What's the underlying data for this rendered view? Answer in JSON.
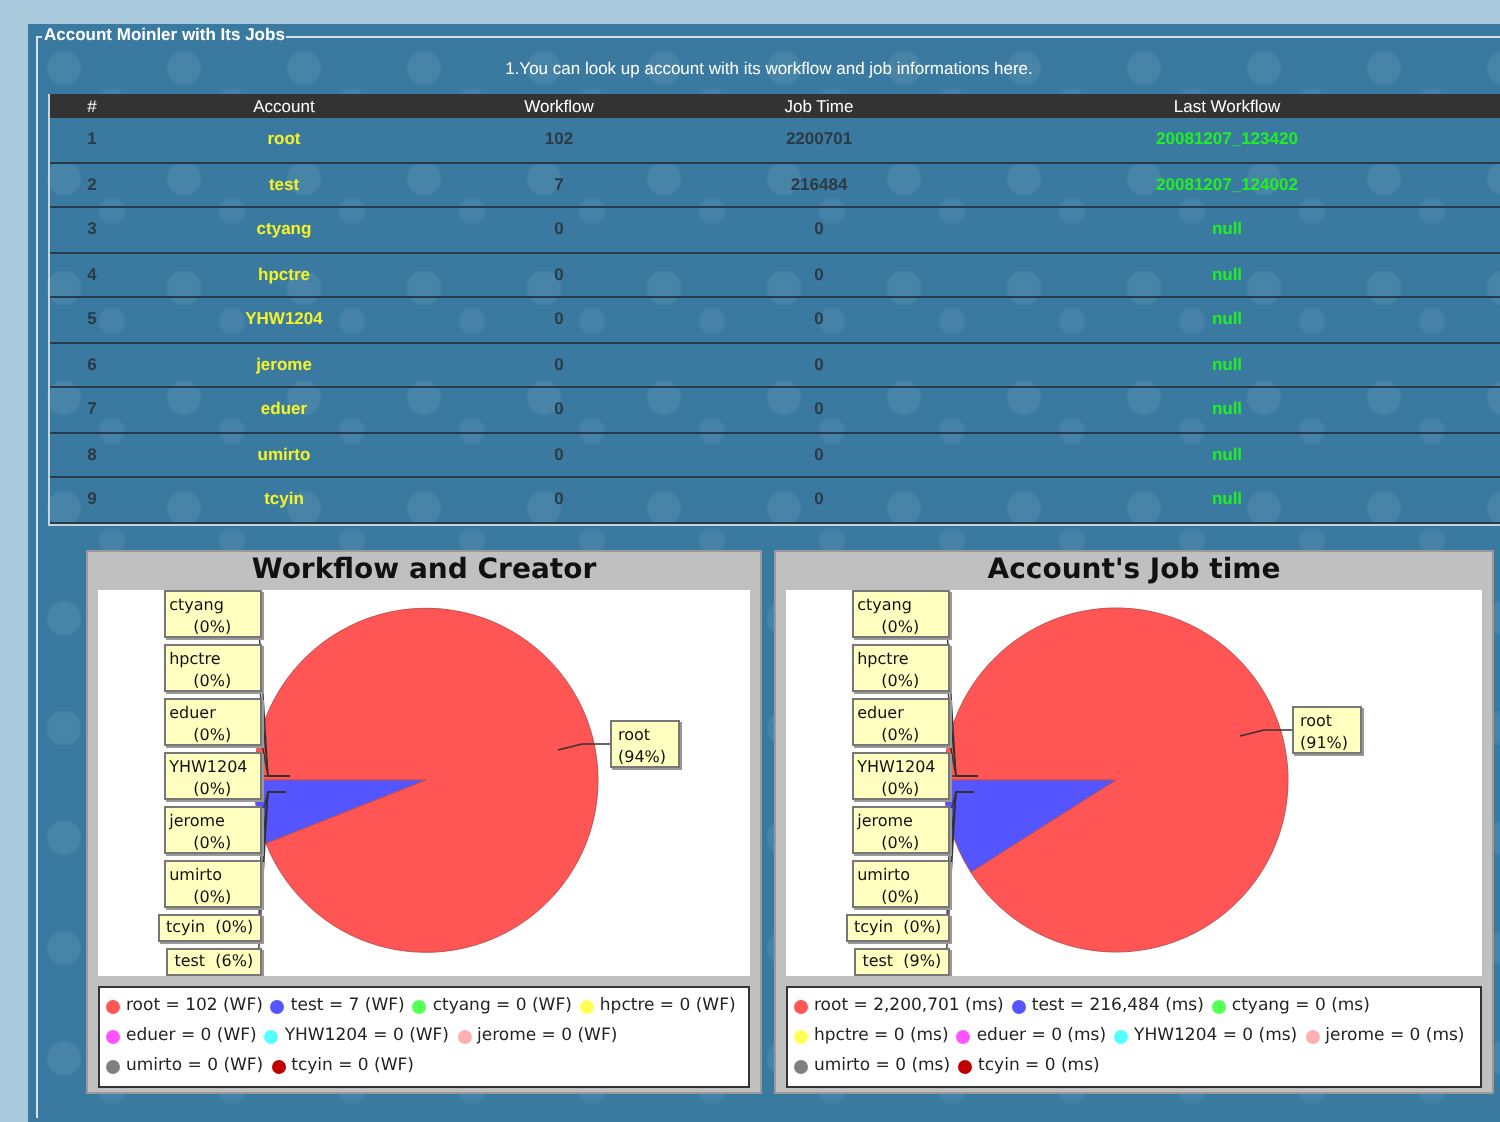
{
  "panel": {
    "title": "Account Moinler with Its Jobs",
    "subtitle": "1.You can look up account with its workflow and job informations here."
  },
  "table": {
    "columns": [
      "#",
      "Account",
      "Workflow",
      "Job Time",
      "Last Workflow"
    ],
    "rows": [
      {
        "number": "1",
        "account": "root",
        "workflow": "102",
        "job_time": "2200701",
        "last_workflow": "20081207_123420"
      },
      {
        "number": "2",
        "account": "test",
        "workflow": "7",
        "job_time": "216484",
        "last_workflow": "20081207_124002"
      },
      {
        "number": "3",
        "account": "ctyang",
        "workflow": "0",
        "job_time": "0",
        "last_workflow": "null"
      },
      {
        "number": "4",
        "account": "hpctre",
        "workflow": "0",
        "job_time": "0",
        "last_workflow": "null"
      },
      {
        "number": "5",
        "account": "YHW1204",
        "workflow": "0",
        "job_time": "0",
        "last_workflow": "null"
      },
      {
        "number": "6",
        "account": "jerome",
        "workflow": "0",
        "job_time": "0",
        "last_workflow": "null"
      },
      {
        "number": "7",
        "account": "eduer",
        "workflow": "0",
        "job_time": "0",
        "last_workflow": "null"
      },
      {
        "number": "8",
        "account": "umirto",
        "workflow": "0",
        "job_time": "0",
        "last_workflow": "null"
      },
      {
        "number": "9",
        "account": "tcyin",
        "workflow": "0",
        "job_time": "0",
        "last_workflow": "null"
      }
    ]
  },
  "charts": [
    {
      "chart_data": {
        "type": "pie",
        "title": "Workflow and Creator",
        "categories": [
          "root",
          "test",
          "ctyang",
          "hpctre",
          "eduer",
          "YHW1204",
          "jerome",
          "umirto",
          "tcyin"
        ],
        "values": [
          94,
          6,
          0,
          0,
          0,
          0,
          0,
          0,
          0
        ]
      },
      "slice_labels": [
        {
          "kind": "callout",
          "percent": "(94%)"
        },
        {
          "kind": "inline",
          "percent": "(6%)"
        },
        {
          "kind": "stacked",
          "percent": "(0%)"
        },
        {
          "kind": "stacked",
          "percent": "(0%)"
        },
        {
          "kind": "stacked",
          "percent": "(0%)"
        },
        {
          "kind": "stacked",
          "percent": "(0%)"
        },
        {
          "kind": "stacked",
          "percent": "(0%)"
        },
        {
          "kind": "stacked",
          "percent": "(0%)"
        },
        {
          "kind": "inline",
          "percent": "(0%)"
        }
      ],
      "legend": [
        {
          "text": "root = 102 (WF)",
          "color": "#ff5555"
        },
        {
          "text": "test = 7 (WF)",
          "color": "#5555ff"
        },
        {
          "text": "ctyang = 0 (WF)",
          "color": "#55ff55"
        },
        {
          "text": "hpctre = 0 (WF)",
          "color": "#ffff55"
        },
        {
          "text": "eduer = 0 (WF)",
          "color": "#ff55ff"
        },
        {
          "text": "YHW1204 = 0 (WF)",
          "color": "#55ffff"
        },
        {
          "text": "jerome = 0 (WF)",
          "color": "#ffafaf"
        },
        {
          "text": "umirto = 0 (WF)",
          "color": "#808080"
        },
        {
          "text": "tcyin = 0 (WF)",
          "color": "#c00000"
        }
      ]
    },
    {
      "chart_data": {
        "type": "pie",
        "title": "Account's Job time",
        "categories": [
          "root",
          "test",
          "ctyang",
          "hpctre",
          "eduer",
          "YHW1204",
          "jerome",
          "umirto",
          "tcyin"
        ],
        "values": [
          91,
          9,
          0,
          0,
          0,
          0,
          0,
          0,
          0
        ]
      },
      "slice_labels": [
        {
          "kind": "callout",
          "percent": "(91%)"
        },
        {
          "kind": "inline",
          "percent": "(9%)"
        },
        {
          "kind": "stacked",
          "percent": "(0%)"
        },
        {
          "kind": "stacked",
          "percent": "(0%)"
        },
        {
          "kind": "stacked",
          "percent": "(0%)"
        },
        {
          "kind": "stacked",
          "percent": "(0%)"
        },
        {
          "kind": "stacked",
          "percent": "(0%)"
        },
        {
          "kind": "stacked",
          "percent": "(0%)"
        },
        {
          "kind": "inline",
          "percent": "(0%)"
        }
      ],
      "legend": [
        {
          "text": "root = 2,200,701 (ms)",
          "color": "#ff5555"
        },
        {
          "text": "test = 216,484 (ms)",
          "color": "#5555ff"
        },
        {
          "text": "ctyang = 0 (ms)",
          "color": "#55ff55"
        },
        {
          "text": "hpctre = 0 (ms)",
          "color": "#ffff55"
        },
        {
          "text": "eduer = 0 (ms)",
          "color": "#ff55ff"
        },
        {
          "text": "YHW1204 = 0 (ms)",
          "color": "#55ffff"
        },
        {
          "text": "jerome = 0 (ms)",
          "color": "#ffafaf"
        },
        {
          "text": "umirto = 0 (ms)",
          "color": "#808080"
        },
        {
          "text": "tcyin = 0 (ms)",
          "color": "#c00000"
        }
      ]
    }
  ]
}
